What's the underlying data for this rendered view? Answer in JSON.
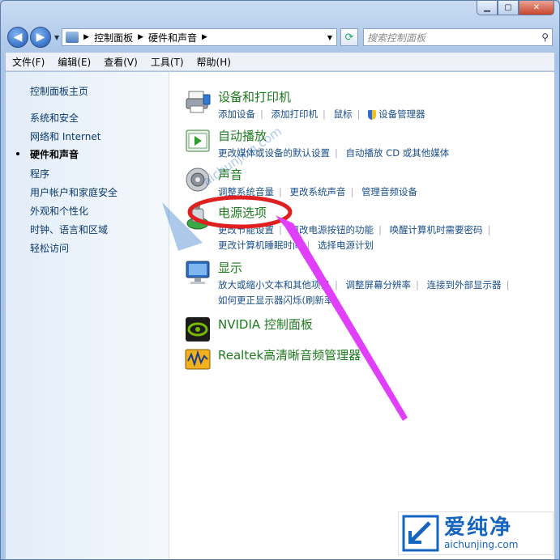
{
  "window": {
    "min": "▁",
    "max": "▢",
    "close": "✕"
  },
  "address": {
    "crumbs": [
      "控制面板",
      "硬件和声音"
    ]
  },
  "search": {
    "placeholder": "搜索控制面板"
  },
  "menu": [
    "文件(F)",
    "编辑(E)",
    "查看(V)",
    "工具(T)",
    "帮助(H)"
  ],
  "sidebar": {
    "items": [
      {
        "label": "控制面板主页"
      },
      {
        "label": "系统和安全"
      },
      {
        "label": "网络和 Internet"
      },
      {
        "label": "硬件和声音",
        "active": true
      },
      {
        "label": "程序"
      },
      {
        "label": "用户帐户和家庭安全"
      },
      {
        "label": "外观和个性化"
      },
      {
        "label": "时钟、语言和区域"
      },
      {
        "label": "轻松访问"
      }
    ]
  },
  "categories": [
    {
      "title": "设备和打印机",
      "icon": "printer-icon",
      "lines": [
        [
          "添加设备",
          "添加打印机",
          "鼠标",
          "设备管理器"
        ]
      ]
    },
    {
      "title": "自动播放",
      "icon": "autoplay-icon",
      "lines": [
        [
          "更改媒体或设备的默认设置",
          "自动播放 CD 或其他媒体"
        ]
      ]
    },
    {
      "title": "声音",
      "icon": "speaker-icon",
      "lines": [
        [
          "调整系统音量",
          "更改系统声音",
          "管理音频设备"
        ]
      ]
    },
    {
      "title": "电源选项",
      "icon": "power-options-icon",
      "lines": [
        [
          "更改节能设置",
          "更改电源按钮的功能",
          "唤醒计算机时需要密码"
        ],
        [
          "更改计算机睡眠时间",
          "选择电源计划"
        ]
      ]
    },
    {
      "title": "显示",
      "icon": "display-icon",
      "lines": [
        [
          "放大或缩小文本和其他项目",
          "调整屏幕分辨率",
          "连接到外部显示器"
        ],
        [
          "如何更正显示器闪烁(刷新率)"
        ]
      ]
    },
    {
      "title": "NVIDIA 控制面板",
      "icon": "nvidia-icon",
      "lines": []
    },
    {
      "title": "Realtek高清晰音频管理器",
      "icon": "realtek-icon",
      "lines": []
    }
  ],
  "watermark": {
    "brand": "爱纯净",
    "url": "aichunjing.com",
    "diag": "aichunjing.com"
  },
  "colors": {
    "category_title": "#1e7a1e",
    "link": "#1a4f8a",
    "annotation_red": "#e02020",
    "annotation_arrow": "#e040fb"
  }
}
